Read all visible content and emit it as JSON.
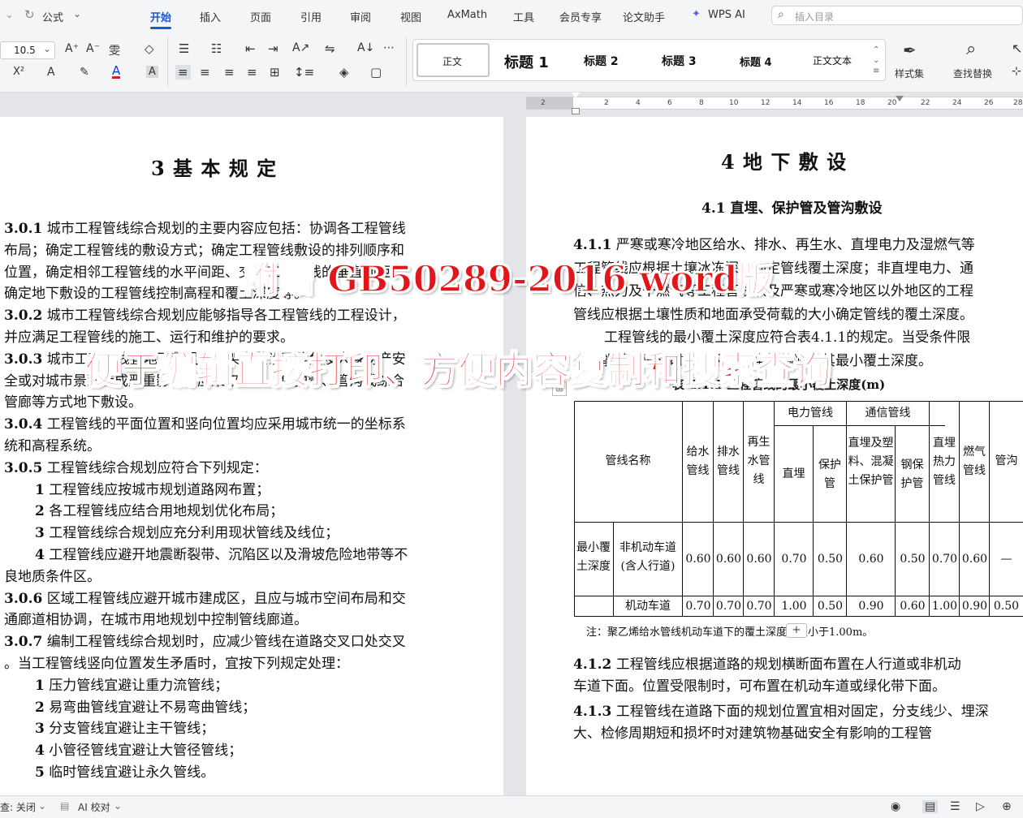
{
  "tabs": {
    "formula": "公式",
    "start": "开始",
    "insert": "插入",
    "page": "页面",
    "ref": "引用",
    "review": "审阅",
    "view": "视图",
    "axmath": "AxMath",
    "tools": "工具",
    "member": "会员专享",
    "thesis": "论文助手",
    "wpsai": "WPS AI",
    "search_placeholder": "插入目录"
  },
  "ribbon": {
    "font_size": "10.5",
    "pinyin": "雯",
    "styles": [
      "正文",
      "标题 1",
      "标题 2",
      "标题 3",
      "标题 4",
      "正文文本"
    ],
    "style_set": "样式集",
    "find_replace": "查找替换"
  },
  "ruler": {
    "numbers": [
      "2",
      "2",
      "4",
      "6",
      "8",
      "10",
      "12",
      "14",
      "16",
      "18",
      "20",
      "22",
      "24",
      "26",
      "28"
    ]
  },
  "left_page": {
    "heading": "3 基 本 规 定",
    "lines": [
      {
        "num": "3.0.1",
        "text": " 城市工程管线综合规划的主要内容应包括：协调各工程管线"
      },
      {
        "text": "布局；确定工程管线的敷设方式；确定工程管线敷设的排列顺序和"
      },
      {
        "text": "位置，确定相邻工程管线的水平间距、交叉工程管线的垂直间距；"
      },
      {
        "text": "确定地下敷设的工程管线控制高程和覆土深度等。"
      },
      {
        "num": "3.0.2",
        "text": " 城市工程管线综合规划应能够指导各工程管线的工程设计，"
      },
      {
        "text": "并应满足工程管线的施工、运行和维护的要求。"
      },
      {
        "num": "3.0.3",
        "text": " 城市工程管线宜地下敷设，当架空敷设可能危及人身财产安"
      },
      {
        "text": "全或对城市景观造成严重影响时应采取直埋、保护管、管沟或综合"
      },
      {
        "text": "管廊等方式地下敷设。"
      },
      {
        "num": "3.0.4",
        "text": " 工程管线的平面位置和竖向位置均应采用城市统一的坐标系"
      },
      {
        "text": "统和高程系统。"
      },
      {
        "num": "3.0.5",
        "text": " 工程管线综合规划应符合下列规定："
      },
      {
        "num": "1",
        "text": " 工程管线应按城市规划道路网布置；",
        "indent": true
      },
      {
        "num": "2",
        "text": " 各工程管线应结合用地规划优化布局；",
        "indent": true
      },
      {
        "num": "3",
        "text": " 工程管线综合规划应充分利用现状管线及线位；",
        "indent": true
      },
      {
        "num": "4",
        "text": " 工程管线应避开地震断裂带、沉陷区以及滑坡危险地带等不",
        "indent": true
      },
      {
        "text": "良地质条件区。"
      },
      {
        "num": "3.0.6",
        "text": " 区域工程管线应避开城市建成区，且应与城市空间布局和交"
      },
      {
        "text": "通廊道相协调，在城市用地规划中控制管线廊道。"
      },
      {
        "num": "3.0.7",
        "text": " 编制工程管线综合规划时，应减少管线在道路交叉口处交叉"
      },
      {
        "text": "。当工程管线竖向位置发生矛盾时，宜按下列规定处理："
      },
      {
        "num": "1",
        "text": " 压力管线宜避让重力流管线；",
        "indent": true
      },
      {
        "num": "2",
        "text": " 易弯曲管线宜避让不易弯曲管线；",
        "indent": true
      },
      {
        "num": "3",
        "text": " 分支管线宜避让主干管线；",
        "indent": true
      },
      {
        "num": "4",
        "text": " 小管径管线宜避让大管径管线；",
        "indent": true
      },
      {
        "num": "5",
        "text": " 临时管线宜避让永久管线。",
        "indent": true
      }
    ]
  },
  "right_page": {
    "heading": "4 地 下 敷 设",
    "subheading": "4.1 直埋、保护管及管沟敷设",
    "lines_top": [
      {
        "num": "4.1.1",
        "text": " 严寒或寒冷地区给水、排水、再生水、直埋电力及湿燃气等"
      },
      {
        "text": "工程管线应根据土壤冰冻深度确定管线覆土深度；非直埋电力、通"
      },
      {
        "text": "信、热力及干燃气等工程管线以及严寒或寒冷地区以外地区的工程"
      },
      {
        "text": "管线应根据土壤性质和地面承受荷载的大小确定管线的覆土深度。"
      },
      {
        "text": "工程管线的最小覆土深度应符合表4.1.1的规定。当受条件限",
        "indent": true
      },
      {
        "text": "制不能满足要求时，可采取安全措施减少其最小覆土深度。"
      }
    ],
    "table_title": "表 4.1.1 工程管线的最小覆土深度(m)",
    "table": {
      "col_head": "管线名称",
      "headers": [
        "给水管线",
        "排水管线",
        "再生水管线",
        "直埋",
        "保护管",
        "直埋及塑料、混凝土保护管",
        "钢保护管",
        "直埋热力管线",
        "燃气管线",
        "管沟"
      ],
      "group_power": "电力管线",
      "group_telecom": "通信管线",
      "row_group": "最小覆土深度",
      "rows": [
        {
          "label": "非机动车道(含人行道)",
          "values": [
            "0.60",
            "0.60",
            "0.60",
            "0.70",
            "0.50",
            "0.60",
            "0.50",
            "0.70",
            "0.60",
            "—"
          ]
        },
        {
          "label": "机动车道",
          "values": [
            "0.70",
            "0.70",
            "0.70",
            "1.00",
            "0.50",
            "0.90",
            "0.60",
            "1.00",
            "0.90",
            "0.50"
          ]
        }
      ]
    },
    "note": "注：聚乙烯给水管线机动车道下的覆土深度不宜小于1.00m。",
    "lines_bottom": [
      {
        "num": "4.1.2",
        "text": " 工程管线应根据道路的规划横断面布置在人行道或非机动"
      },
      {
        "text": "车道下面。位置受限制时，可布置在机动车道或绿化带下面。"
      },
      {
        "num": "4.1.3",
        "text": " 工程管线在道路下面的规划位置宜相对固定，分支线少、埋深"
      },
      {
        "text": "大、检修周期短和损坏时对建筑物基础安全有影响的工程管"
      }
    ]
  },
  "overlay": {
    "line1": "附赠 GB50289-2016 word版",
    "line2": "便于编辑直接打印、方便内容复制和搜索查询"
  },
  "status": {
    "check": "查: 关闭",
    "ai": "AI 校对"
  },
  "colors": {
    "accent": "#1a57d6",
    "overlay_red": "#e0161b"
  }
}
